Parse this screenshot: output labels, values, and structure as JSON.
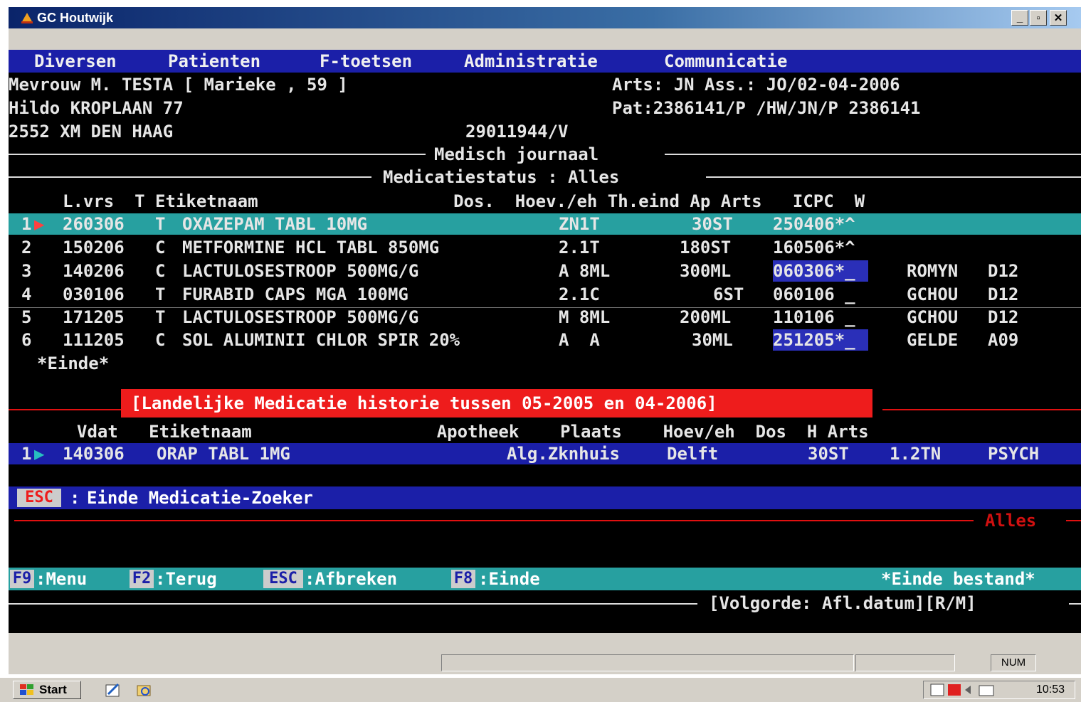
{
  "window": {
    "title": "GC Houtwijk",
    "min": "_",
    "max": "▫",
    "close": "✕"
  },
  "menu": [
    "Diversen",
    "Patienten",
    "F-toetsen",
    "Administratie",
    "Communicatie"
  ],
  "patient": {
    "line1": "Mevrouw M. TESTA [ Marieke , 59 ]",
    "arts": "Arts: JN Ass.: JO/02-04-2006",
    "address": "Hildo KROPLAAN 77",
    "pat": "Pat:2386141/P /HW/JN/P 2386141",
    "city": "2552 XM DEN HAAG",
    "dob": "29011944/V"
  },
  "journal_title": "Medisch journaal",
  "status_title": "Medicatiestatus : Alles",
  "med_header": "L.vrs  T Etiketnaam                   Dos.  Hoev./eh Th.eind Ap Arts   ICPC  W",
  "medications": [
    {
      "num": "1",
      "date": "260306",
      "t": "T",
      "name": "OXAZEPAM TABL 10MG",
      "dos": "ZN1T",
      "qty": "30ST",
      "end": "250406*^",
      "arts": "",
      "icpc": ""
    },
    {
      "num": "2",
      "date": "150206",
      "t": "C",
      "name": "METFORMINE HCL TABL 850MG",
      "dos": "2.1T",
      "qty": "180ST",
      "end": "160506*^",
      "arts": "",
      "icpc": ""
    },
    {
      "num": "3",
      "date": "140206",
      "t": "C",
      "name": "LACTULOSESTROOP 500MG/G",
      "dos": "A 8ML",
      "qty": "300ML",
      "end": "060306*_",
      "arts": "ROMYN",
      "icpc": "D12"
    },
    {
      "num": "4",
      "date": "030106",
      "t": "T",
      "name": "FURABID CAPS MGA 100MG",
      "dos": "2.1C",
      "qty": "6ST",
      "end": "060106 _",
      "arts": "GCHOU",
      "icpc": "D12"
    },
    {
      "num": "5",
      "date": "171205",
      "t": "T",
      "name": "LACTULOSESTROOP 500MG/G",
      "dos": "M 8ML",
      "qty": "200ML",
      "end": "110106 _",
      "arts": "GCHOU",
      "icpc": "D12"
    },
    {
      "num": "6",
      "date": "111205",
      "t": "C",
      "name": "SOL ALUMINII CHLOR SPIR 20%",
      "dos": "A  A",
      "qty": "30ML",
      "end": "251205*_",
      "arts": "GELDE",
      "icpc": "A09"
    }
  ],
  "einde_marker": "*Einde*",
  "history_banner": "[Landelijke Medicatie historie tussen 05-2005 en 04-2006]",
  "history_header": "Vdat   Etiketnaam                  Apotheek    Plaats    Hoev/eh  Dos  H Arts",
  "history": [
    {
      "num": "1",
      "date": "140306",
      "name": "ORAP TABL 1MG",
      "apotheek": "Alg.Zknhuis",
      "plaats": "Delft",
      "qty": "30ST",
      "dos": "1.2TN",
      "arts": "PSYCH"
    }
  ],
  "esc_bar": {
    "key": "ESC",
    "sep": ":",
    "label": "Einde Medicatie-Zoeker"
  },
  "alles_label": "Alles",
  "fkeys": [
    {
      "key": "F9",
      "label": ":Menu"
    },
    {
      "key": "F2",
      "label": ":Terug"
    },
    {
      "key": "ESC",
      "label": ":Afbreken"
    },
    {
      "key": "F8",
      "label": ":Einde"
    }
  ],
  "einde_bestand": "*Einde bestand*",
  "volgorde": "[Volgorde: Afl.datum][R/M]",
  "statusbar": {
    "num": "NUM"
  },
  "taskbar": {
    "start": "Start",
    "clock": "10:53"
  },
  "colors": {
    "menu_bg": "#1b1fa8",
    "cyan_row": "#27a0a0",
    "red_banner": "#ee1c1c"
  }
}
